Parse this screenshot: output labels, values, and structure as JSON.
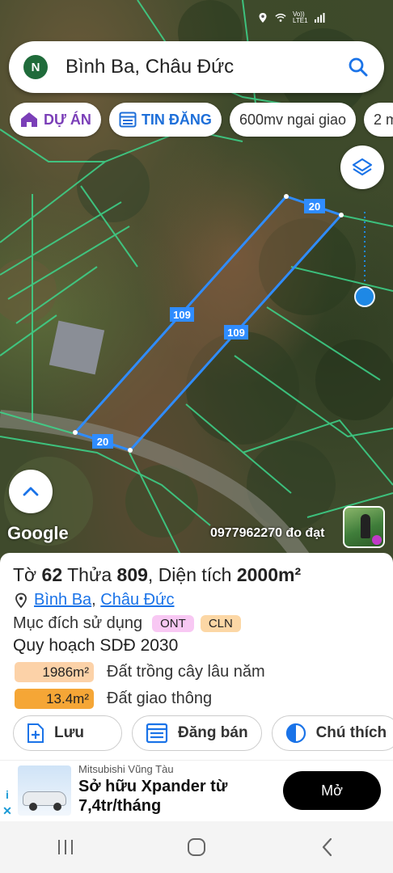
{
  "status_bar": {
    "network_label": "Vo)) LTE1"
  },
  "search": {
    "avatar_letter": "N",
    "query": "Bình Ba, Châu Đức"
  },
  "chips": [
    {
      "label": "DỰ ÁN",
      "icon": "house-icon"
    },
    {
      "label": "TIN ĐĂNG",
      "icon": "listing-icon"
    },
    {
      "label": "600mv ngai giao"
    },
    {
      "label": "2 m"
    }
  ],
  "map": {
    "edge_labels": [
      "20",
      "109",
      "109",
      "20"
    ],
    "google_label": "Google",
    "watermark": "0977962270 đo đạt"
  },
  "parcel": {
    "sheet_label": "Tờ",
    "sheet_no": "62",
    "plot_label": "Thửa",
    "plot_no": "809",
    "area_label": "Diện tích",
    "area_value": "2000m²",
    "commune": "Bình Ba",
    "district": "Châu Đức",
    "purpose_label": "Mục đích sử dụng",
    "purpose_tags": [
      "ONT",
      "CLN"
    ],
    "planning_title": "Quy hoạch SDĐ 2030",
    "planning_rows": [
      {
        "area": "1986m²",
        "desc": "Đất trồng cây lâu năm",
        "color": "#fcd2a8"
      },
      {
        "area": "13.4m²",
        "desc": "Đất giao thông",
        "color": "#f5a636"
      }
    ]
  },
  "actions": [
    {
      "label": "Lưu",
      "icon": "save-icon"
    },
    {
      "label": "Đăng bán",
      "icon": "listing-icon"
    },
    {
      "label": "Chú thích",
      "icon": "legend-icon"
    }
  ],
  "ad": {
    "sponsor": "Mitsubishi Vũng Tàu",
    "headline": "Sở hữu Xpander từ 7,4tr/tháng",
    "cta": "Mở",
    "info_i": "i",
    "info_x": "✕"
  }
}
